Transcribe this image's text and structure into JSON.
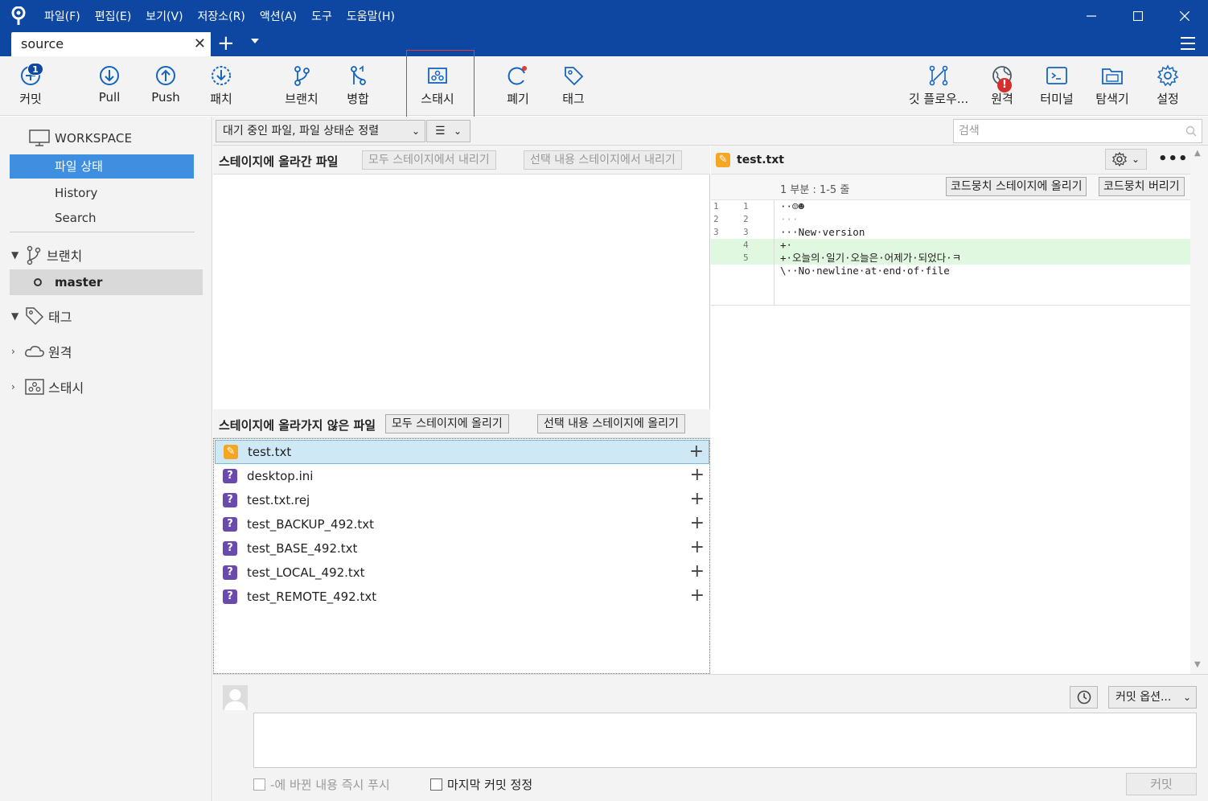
{
  "menu": [
    "파일(F)",
    "편집(E)",
    "보기(V)",
    "저장소(R)",
    "액션(A)",
    "도구",
    "도움말(H)"
  ],
  "tab": {
    "label": "source",
    "close": "✕",
    "add": "+"
  },
  "toolbar": {
    "commit": {
      "label": "커밋",
      "badge": "1"
    },
    "pull": "Pull",
    "push": "Push",
    "patch": "패치",
    "branch": "브랜치",
    "merge": "병합",
    "stash": "스태시",
    "discard": "폐기",
    "tag": "태그",
    "gitflow": "깃 플로우...",
    "remote": {
      "label": "원격",
      "alert": "!"
    },
    "terminal": "터미널",
    "explorer": "탐색기",
    "settings": "설정"
  },
  "sidebar": {
    "workspace": "WORKSPACE",
    "items": [
      "파일 상태",
      "History",
      "Search"
    ],
    "branches": "브랜치",
    "current_branch": "master",
    "tags": "태그",
    "remotes": "원격",
    "stashes": "스태시"
  },
  "filter": {
    "sort": "대기 중인 파일, 파일 상태순 정렬",
    "view": "☰",
    "search_placeholder": "검색"
  },
  "staged": {
    "title": "스테이지에 올라간 파일",
    "unstage_all": "모두 스테이지에서 내리기",
    "unstage_selected": "선택 내용 스테이지에서 내리기"
  },
  "unstaged": {
    "title": "스테이지에 올라가지 않은 파일",
    "stage_all": "모두 스테이지에 올리기",
    "stage_selected": "선택 내용 스테이지에 올리기",
    "files": [
      {
        "name": "test.txt",
        "status": "modified"
      },
      {
        "name": "desktop.ini",
        "status": "untracked"
      },
      {
        "name": "test.txt.rej",
        "status": "untracked"
      },
      {
        "name": "test_BACKUP_492.txt",
        "status": "untracked"
      },
      {
        "name": "test_BASE_492.txt",
        "status": "untracked"
      },
      {
        "name": "test_LOCAL_492.txt",
        "status": "untracked"
      },
      {
        "name": "test_REMOTE_492.txt",
        "status": "untracked"
      }
    ]
  },
  "diff": {
    "file": "test.txt",
    "hunk_info": "1 부분 : 1-5 줄",
    "stage_hunk": "코드뭉치 스테이지에 올리기",
    "discard_hunk": "코드뭉치 버리기",
    "lines": [
      {
        "old": "1",
        "new": "1",
        "text": "··☺☻",
        "type": "ctx"
      },
      {
        "old": "2",
        "new": "2",
        "text": "···",
        "type": "ctx"
      },
      {
        "old": "3",
        "new": "3",
        "text": "···New·version",
        "type": "ctx"
      },
      {
        "old": "",
        "new": "4",
        "text": "+·",
        "type": "add"
      },
      {
        "old": "",
        "new": "5",
        "text": "+·오늘의·일기·오늘은·어제가·되었다·ㅋ",
        "type": "add"
      },
      {
        "old": "",
        "new": "",
        "text": "\\··No·newline·at·end·of·file",
        "type": "ctx"
      }
    ]
  },
  "commit": {
    "options": "커밋 옵션...",
    "push_now": "-에 바뀐 내용 즉시 푸시",
    "amend": "마지막 커밋 정정",
    "button": "커밋"
  },
  "colors": {
    "titlebar": "#0d47a1",
    "selection": "#3f8ee0",
    "added_line": "#e0f8df",
    "modified_icon": "#f5a623",
    "untracked_icon": "#6b4ab0",
    "alert": "#d32f2f"
  }
}
